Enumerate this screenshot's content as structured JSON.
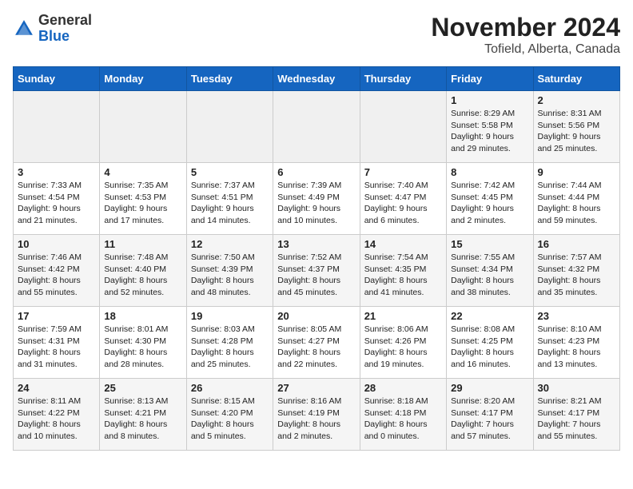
{
  "header": {
    "logo_general": "General",
    "logo_blue": "Blue",
    "month": "November 2024",
    "location": "Tofield, Alberta, Canada"
  },
  "weekdays": [
    "Sunday",
    "Monday",
    "Tuesday",
    "Wednesday",
    "Thursday",
    "Friday",
    "Saturday"
  ],
  "weeks": [
    [
      {
        "day": "",
        "info": "",
        "empty": true
      },
      {
        "day": "",
        "info": "",
        "empty": true
      },
      {
        "day": "",
        "info": "",
        "empty": true
      },
      {
        "day": "",
        "info": "",
        "empty": true
      },
      {
        "day": "",
        "info": "",
        "empty": true
      },
      {
        "day": "1",
        "info": "Sunrise: 8:29 AM\nSunset: 5:58 PM\nDaylight: 9 hours\nand 29 minutes.",
        "empty": false
      },
      {
        "day": "2",
        "info": "Sunrise: 8:31 AM\nSunset: 5:56 PM\nDaylight: 9 hours\nand 25 minutes.",
        "empty": false
      }
    ],
    [
      {
        "day": "3",
        "info": "Sunrise: 7:33 AM\nSunset: 4:54 PM\nDaylight: 9 hours\nand 21 minutes.",
        "empty": false
      },
      {
        "day": "4",
        "info": "Sunrise: 7:35 AM\nSunset: 4:53 PM\nDaylight: 9 hours\nand 17 minutes.",
        "empty": false
      },
      {
        "day": "5",
        "info": "Sunrise: 7:37 AM\nSunset: 4:51 PM\nDaylight: 9 hours\nand 14 minutes.",
        "empty": false
      },
      {
        "day": "6",
        "info": "Sunrise: 7:39 AM\nSunset: 4:49 PM\nDaylight: 9 hours\nand 10 minutes.",
        "empty": false
      },
      {
        "day": "7",
        "info": "Sunrise: 7:40 AM\nSunset: 4:47 PM\nDaylight: 9 hours\nand 6 minutes.",
        "empty": false
      },
      {
        "day": "8",
        "info": "Sunrise: 7:42 AM\nSunset: 4:45 PM\nDaylight: 9 hours\nand 2 minutes.",
        "empty": false
      },
      {
        "day": "9",
        "info": "Sunrise: 7:44 AM\nSunset: 4:44 PM\nDaylight: 8 hours\nand 59 minutes.",
        "empty": false
      }
    ],
    [
      {
        "day": "10",
        "info": "Sunrise: 7:46 AM\nSunset: 4:42 PM\nDaylight: 8 hours\nand 55 minutes.",
        "empty": false
      },
      {
        "day": "11",
        "info": "Sunrise: 7:48 AM\nSunset: 4:40 PM\nDaylight: 8 hours\nand 52 minutes.",
        "empty": false
      },
      {
        "day": "12",
        "info": "Sunrise: 7:50 AM\nSunset: 4:39 PM\nDaylight: 8 hours\nand 48 minutes.",
        "empty": false
      },
      {
        "day": "13",
        "info": "Sunrise: 7:52 AM\nSunset: 4:37 PM\nDaylight: 8 hours\nand 45 minutes.",
        "empty": false
      },
      {
        "day": "14",
        "info": "Sunrise: 7:54 AM\nSunset: 4:35 PM\nDaylight: 8 hours\nand 41 minutes.",
        "empty": false
      },
      {
        "day": "15",
        "info": "Sunrise: 7:55 AM\nSunset: 4:34 PM\nDaylight: 8 hours\nand 38 minutes.",
        "empty": false
      },
      {
        "day": "16",
        "info": "Sunrise: 7:57 AM\nSunset: 4:32 PM\nDaylight: 8 hours\nand 35 minutes.",
        "empty": false
      }
    ],
    [
      {
        "day": "17",
        "info": "Sunrise: 7:59 AM\nSunset: 4:31 PM\nDaylight: 8 hours\nand 31 minutes.",
        "empty": false
      },
      {
        "day": "18",
        "info": "Sunrise: 8:01 AM\nSunset: 4:30 PM\nDaylight: 8 hours\nand 28 minutes.",
        "empty": false
      },
      {
        "day": "19",
        "info": "Sunrise: 8:03 AM\nSunset: 4:28 PM\nDaylight: 8 hours\nand 25 minutes.",
        "empty": false
      },
      {
        "day": "20",
        "info": "Sunrise: 8:05 AM\nSunset: 4:27 PM\nDaylight: 8 hours\nand 22 minutes.",
        "empty": false
      },
      {
        "day": "21",
        "info": "Sunrise: 8:06 AM\nSunset: 4:26 PM\nDaylight: 8 hours\nand 19 minutes.",
        "empty": false
      },
      {
        "day": "22",
        "info": "Sunrise: 8:08 AM\nSunset: 4:25 PM\nDaylight: 8 hours\nand 16 minutes.",
        "empty": false
      },
      {
        "day": "23",
        "info": "Sunrise: 8:10 AM\nSunset: 4:23 PM\nDaylight: 8 hours\nand 13 minutes.",
        "empty": false
      }
    ],
    [
      {
        "day": "24",
        "info": "Sunrise: 8:11 AM\nSunset: 4:22 PM\nDaylight: 8 hours\nand 10 minutes.",
        "empty": false
      },
      {
        "day": "25",
        "info": "Sunrise: 8:13 AM\nSunset: 4:21 PM\nDaylight: 8 hours\nand 8 minutes.",
        "empty": false
      },
      {
        "day": "26",
        "info": "Sunrise: 8:15 AM\nSunset: 4:20 PM\nDaylight: 8 hours\nand 5 minutes.",
        "empty": false
      },
      {
        "day": "27",
        "info": "Sunrise: 8:16 AM\nSunset: 4:19 PM\nDaylight: 8 hours\nand 2 minutes.",
        "empty": false
      },
      {
        "day": "28",
        "info": "Sunrise: 8:18 AM\nSunset: 4:18 PM\nDaylight: 8 hours\nand 0 minutes.",
        "empty": false
      },
      {
        "day": "29",
        "info": "Sunrise: 8:20 AM\nSunset: 4:17 PM\nDaylight: 7 hours\nand 57 minutes.",
        "empty": false
      },
      {
        "day": "30",
        "info": "Sunrise: 8:21 AM\nSunset: 4:17 PM\nDaylight: 7 hours\nand 55 minutes.",
        "empty": false
      }
    ]
  ]
}
